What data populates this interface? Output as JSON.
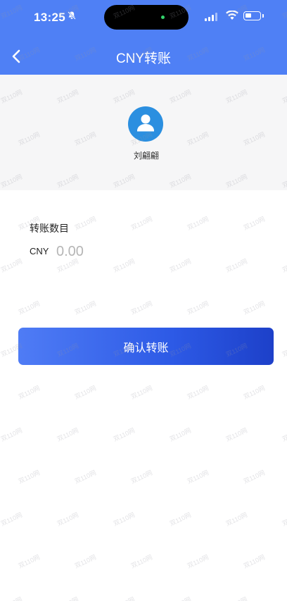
{
  "status_bar": {
    "time": "13:25"
  },
  "nav": {
    "title": "CNY转账"
  },
  "profile": {
    "name": "刘翩翩"
  },
  "form": {
    "amount_label": "转账数目",
    "currency": "CNY",
    "amount_placeholder": "0.00",
    "amount_value": ""
  },
  "actions": {
    "confirm_label": "确认转账"
  },
  "watermark_text": "双110网",
  "colors": {
    "header": "#4f80f5",
    "button_start": "#4f7cf5",
    "button_end": "#1d40c9",
    "avatar": "#2b8fe0"
  },
  "icons": [
    "bell-slash-icon",
    "signal-icon",
    "wifi-icon",
    "battery-icon",
    "back-arrow-icon",
    "user-avatar-icon"
  ]
}
